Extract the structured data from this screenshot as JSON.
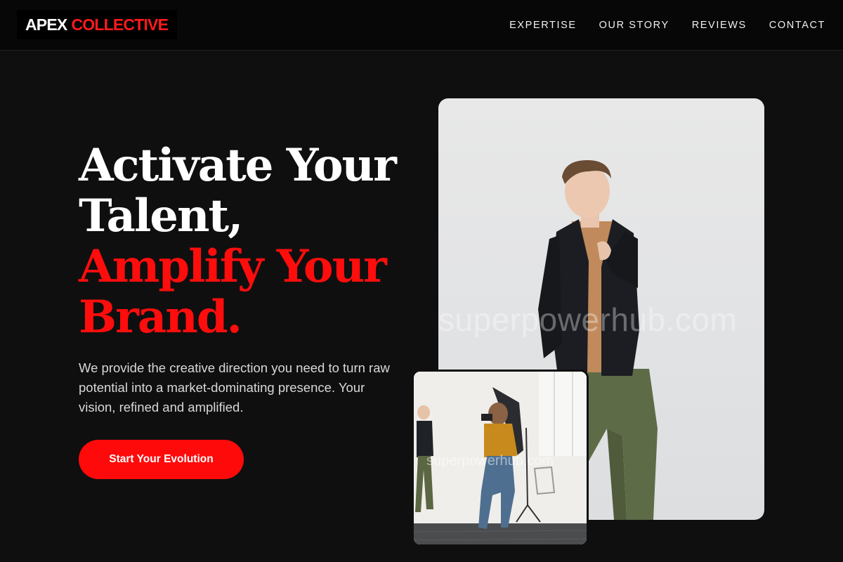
{
  "brand": {
    "name_white": "APEX",
    "name_red": "COLLECTIVE"
  },
  "nav": {
    "items": [
      "EXPERTISE",
      "OUR STORY",
      "REVIEWS",
      "CONTACT"
    ]
  },
  "hero": {
    "headline_white_1": "Activate Your",
    "headline_white_2": "Talent,",
    "headline_red_1": "Amplify Your",
    "headline_red_2": "Brand.",
    "subtext": "We provide the creative direction you need to turn raw potential into a market-dominating presence. Your vision, refined and amplified.",
    "cta_label": "Start Your Evolution"
  },
  "images": {
    "main_watermark": "superpowerhub.com",
    "small_watermark": "superpowerhub.com"
  },
  "colors": {
    "accent": "#ff0a0a",
    "background": "#0f0f0f",
    "header": "#070707"
  }
}
